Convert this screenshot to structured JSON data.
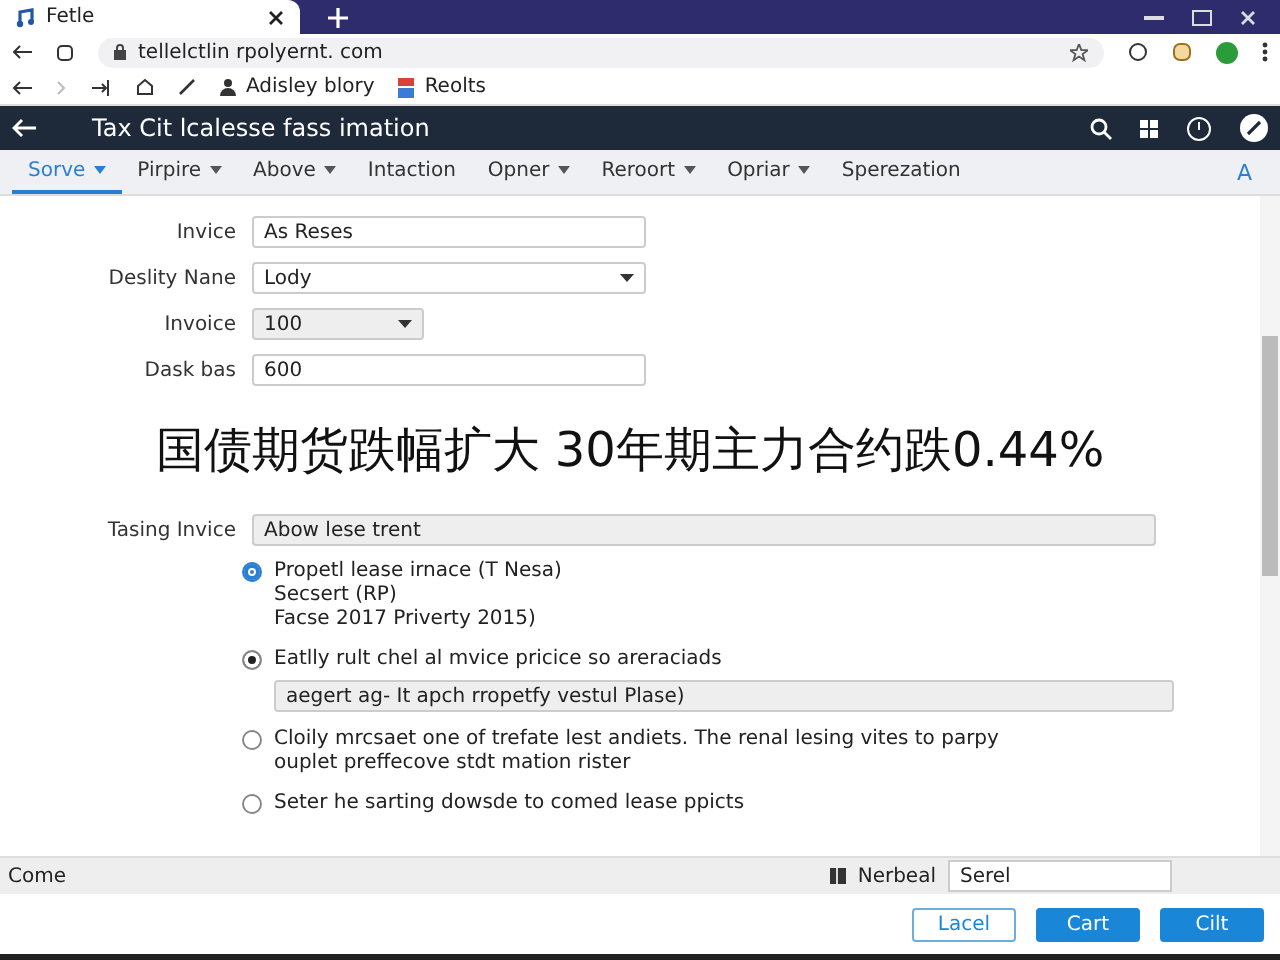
{
  "browser": {
    "tab_title": "Fetle",
    "url": "tellelctlin rpolyernt. com",
    "bookmarks": [
      "Adisley blory",
      "Reolts"
    ]
  },
  "app": {
    "title": "Tax Cit lcalesse fass imation"
  },
  "menu": [
    {
      "label": "Sorve",
      "dropdown": true,
      "selected": true
    },
    {
      "label": "Pirpire",
      "dropdown": true,
      "selected": false
    },
    {
      "label": "Above",
      "dropdown": true,
      "selected": false
    },
    {
      "label": "Intaction",
      "dropdown": false,
      "selected": false
    },
    {
      "label": "Opner",
      "dropdown": true,
      "selected": false
    },
    {
      "label": "Reroort",
      "dropdown": true,
      "selected": false
    },
    {
      "label": "Opriar",
      "dropdown": true,
      "selected": false
    },
    {
      "label": "Sperezation",
      "dropdown": false,
      "selected": false
    }
  ],
  "menu_end": "A",
  "fields": [
    {
      "label": "Invice",
      "value": "As Reses",
      "kind": "text"
    },
    {
      "label": "Deslity Nane",
      "value": "Lody",
      "kind": "select"
    },
    {
      "label": "Invoice",
      "value": "100",
      "kind": "small-select"
    },
    {
      "label": "Dask bas",
      "value": "600",
      "kind": "text"
    }
  ],
  "caption": "国债期货跌幅扩大 30年期主力合约跌0.44%",
  "tasing": {
    "label": "Tasing Invice",
    "value": "Abow lese trent"
  },
  "options": [
    {
      "lines": [
        "Propetl lease irnace (T Nesa)",
        "Secsert (RP)",
        "Facse 2017 Priverty 2015)"
      ],
      "selected": true,
      "kind": "accent"
    },
    {
      "lines": [
        "Eatlly rult chel al mvice pricice so areraciads"
      ],
      "selected": true,
      "kind": "plain",
      "field": "aegert ag- It apch rropetfy vestul Plase)"
    },
    {
      "lines": [
        "Cloily mrcsaet one of trefate lest andiets. The renal lesing vites to parpy",
        "ouplet preffecove stdt mation rister"
      ],
      "selected": false,
      "kind": "plain"
    },
    {
      "lines": [
        "Seter he sarting dowsde to comed lease ppicts"
      ],
      "selected": false,
      "kind": "plain"
    }
  ],
  "status": {
    "left": "Come",
    "label": "Nerbeal",
    "value": "Serel"
  },
  "buttons": [
    {
      "label": "Lacel",
      "kind": "outline"
    },
    {
      "label": "Cart",
      "kind": "primary"
    },
    {
      "label": "Cilt",
      "kind": "primary"
    }
  ]
}
